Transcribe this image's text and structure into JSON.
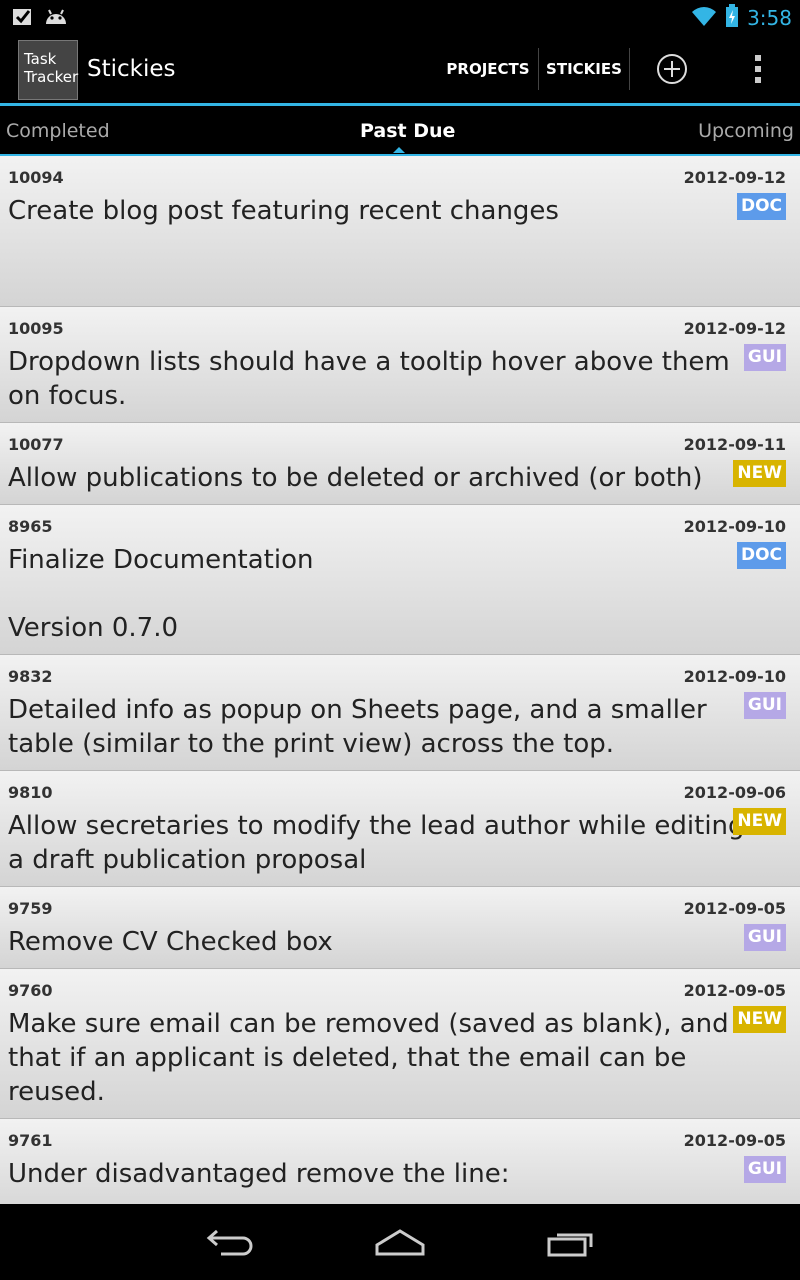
{
  "status_bar": {
    "time": "3:58",
    "icons": [
      "checkbox-icon",
      "android-icon",
      "wifi-icon",
      "battery-charging-icon"
    ]
  },
  "action_bar": {
    "logo_line1": "Task",
    "logo_line2": "Tracker",
    "title": "Stickies",
    "projects_label": "PROJECTS",
    "stickies_label": "STICKIES",
    "add_icon": "plus-circle-icon",
    "overflow_icon": "overflow-menu-icon"
  },
  "tabs": {
    "completed": "Completed",
    "past_due": "Past Due",
    "upcoming": "Upcoming"
  },
  "tasks": [
    {
      "id": "10094",
      "date": "2012-09-12",
      "text": "Create blog post featuring recent changes",
      "tag": "DOC"
    },
    {
      "id": "10095",
      "date": "2012-09-12",
      "text": "Dropdown lists should have a tooltip hover above them on focus.",
      "tag": "GUI"
    },
    {
      "id": "10077",
      "date": "2012-09-11",
      "text": "Allow publications to be deleted or archived (or both)",
      "tag": "NEW"
    },
    {
      "id": "8965",
      "date": "2012-09-10",
      "text": "Finalize Documentation\n\nVersion 0.7.0",
      "tag": "DOC"
    },
    {
      "id": "9832",
      "date": "2012-09-10",
      "text": "Detailed info as popup on Sheets page, and a smaller table (similar to the print view) across the top.",
      "tag": "GUI"
    },
    {
      "id": "9810",
      "date": "2012-09-06",
      "text": "Allow secretaries to modify the lead author while editing a draft publication proposal",
      "tag": "NEW"
    },
    {
      "id": "9759",
      "date": "2012-09-05",
      "text": "Remove CV Checked box",
      "tag": "GUI"
    },
    {
      "id": "9760",
      "date": "2012-09-05",
      "text": "Make sure email can be removed (saved as blank), and that  if an applicant is deleted, that the email can be reused.",
      "tag": "NEW"
    },
    {
      "id": "9761",
      "date": "2012-09-05",
      "text": "Under disadvantaged remove the line:",
      "tag": "GUI"
    }
  ],
  "nav_bar": {
    "back_icon": "back-icon",
    "home_icon": "home-icon",
    "recents_icon": "recent-apps-icon"
  },
  "colors": {
    "accent": "#33b5e5",
    "doc_tag": "#5d9bea",
    "gui_tag": "#b5a8e6",
    "new_tag": "#d8b400"
  }
}
